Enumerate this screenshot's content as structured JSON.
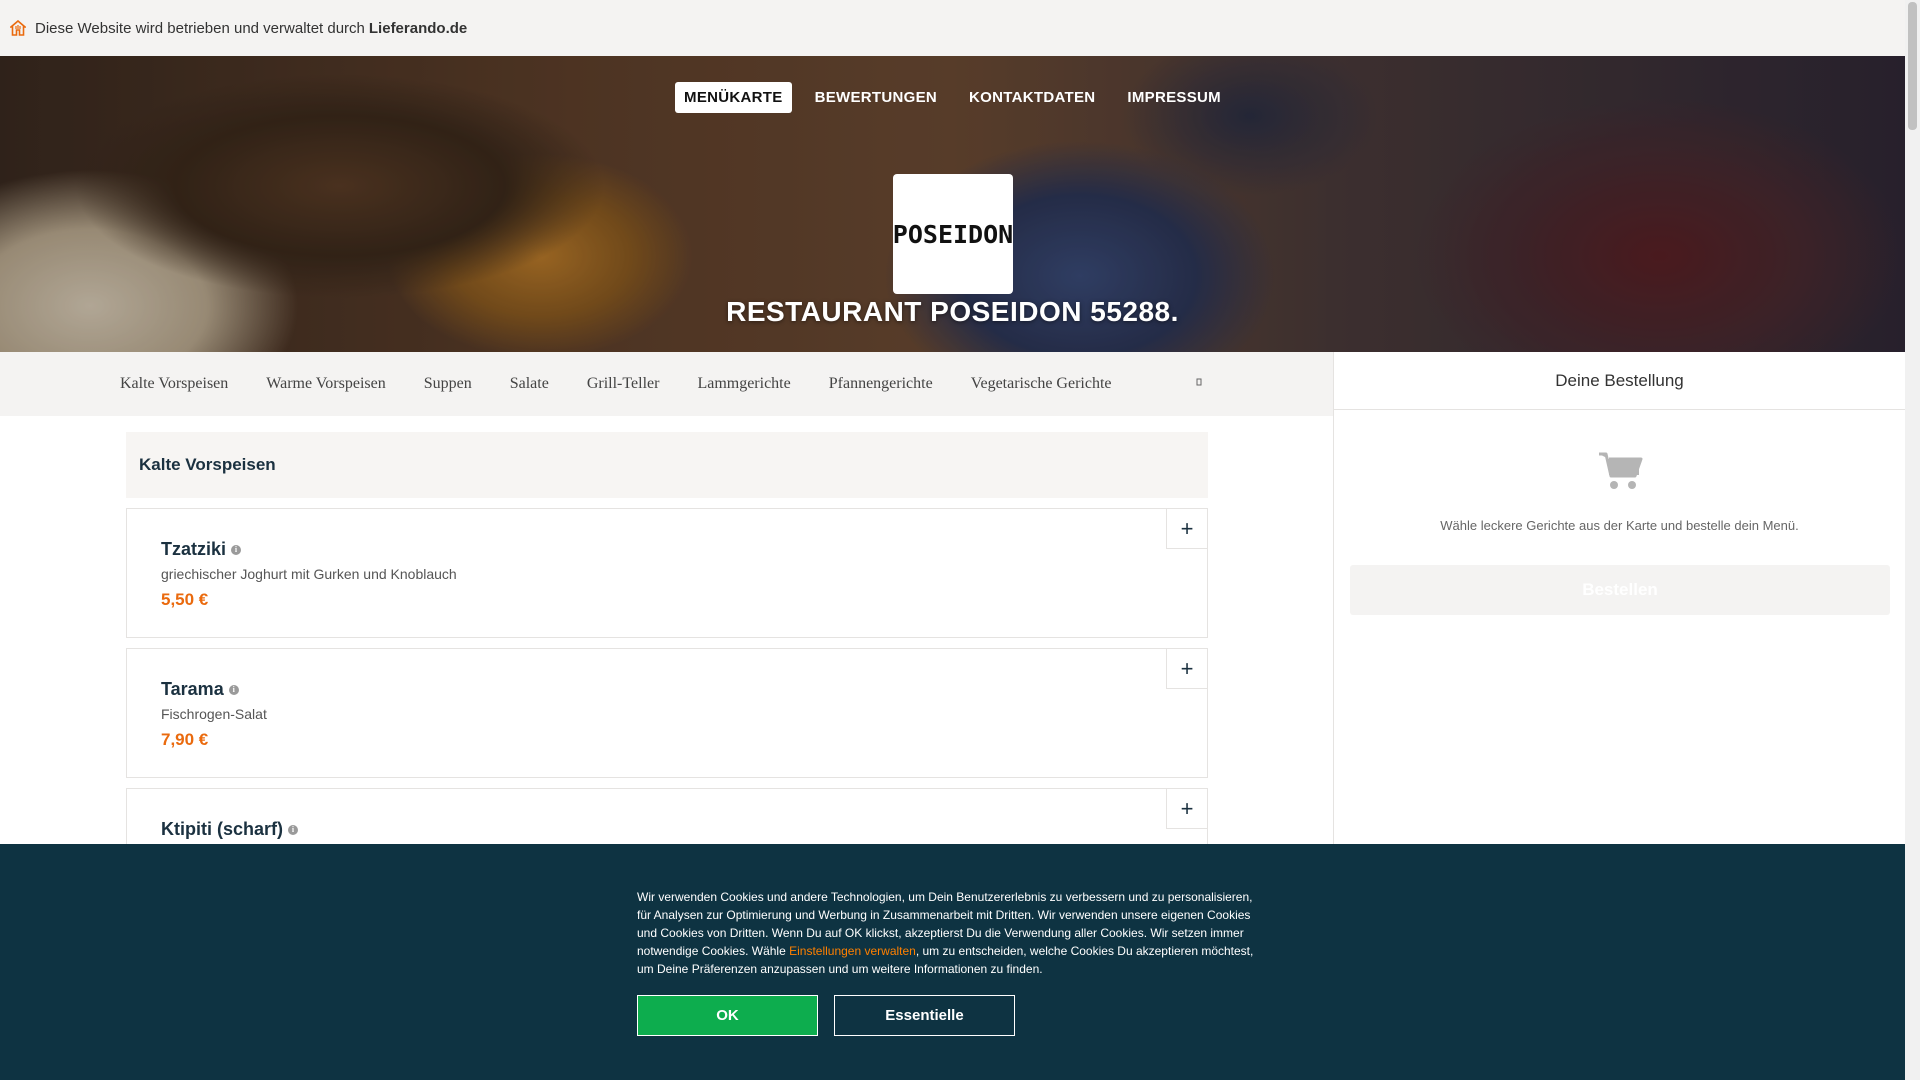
{
  "topbar": {
    "text": "Diese Website wird betrieben und verwaltet durch",
    "brand": "Lieferando.de"
  },
  "nav": [
    {
      "label": "MENÜKARTE",
      "active": true
    },
    {
      "label": "BEWERTUNGEN",
      "active": false
    },
    {
      "label": "KONTAKTDATEN",
      "active": false
    },
    {
      "label": "IMPRESSUM",
      "active": false
    }
  ],
  "restaurant": {
    "logo_text": "POSEIDON",
    "title": "RESTAURANT POSEIDON 55288."
  },
  "categories": [
    "Kalte Vorspeisen",
    "Warme Vorspeisen",
    "Suppen",
    "Salate",
    "Grill-Teller",
    "Lammgerichte",
    "Pfannengerichte",
    "Vegetarische Gerichte"
  ],
  "categories_more_icon": "dropdown-arrow-icon",
  "menu": {
    "section_title": "Kalte Vorspeisen",
    "dishes": [
      {
        "name": "Tzatziki",
        "description": "griechischer Joghurt mit Gurken und Knoblauch",
        "price": "5,50 €"
      },
      {
        "name": "Tarama",
        "description": "Fischrogen-Salat",
        "price": "7,90 €"
      },
      {
        "name": "Ktipiti (scharf)",
        "description": "",
        "price": ""
      }
    ],
    "add_label": "+",
    "info_label": "i"
  },
  "order": {
    "title": "Deine Bestellung",
    "empty_text": "Wähle leckere Gerichte aus der Karte und bestelle dein Menü.",
    "button": "Bestellen"
  },
  "cookie": {
    "text_before": "Wir verwenden Cookies und andere Technologien, um Dein Benutzererlebnis zu verbessern und zu personalisieren, für Analysen zur Optimierung und Werbung in Zusammenarbeit mit Dritten. Wir verwenden unsere eigenen Cookies und Cookies von Dritten. Wenn Du auf OK klickst, akzeptierst Du die Verwendung aller Cookies. Wir setzen immer notwendige Cookies. Wähle ",
    "link": "Einstellungen verwalten",
    "text_after": ", um zu entscheiden, welche Cookies Du akzeptieren möchtest, um Deine Präferenzen anzupassen und um weitere Informationen zu finden.",
    "ok": "OK",
    "essential": "Essentielle"
  },
  "colors": {
    "accent": "#ea6a0e",
    "ok_button": "#0dad4e",
    "cookie_bg": "#0e3342",
    "heading": "#1b3140"
  }
}
